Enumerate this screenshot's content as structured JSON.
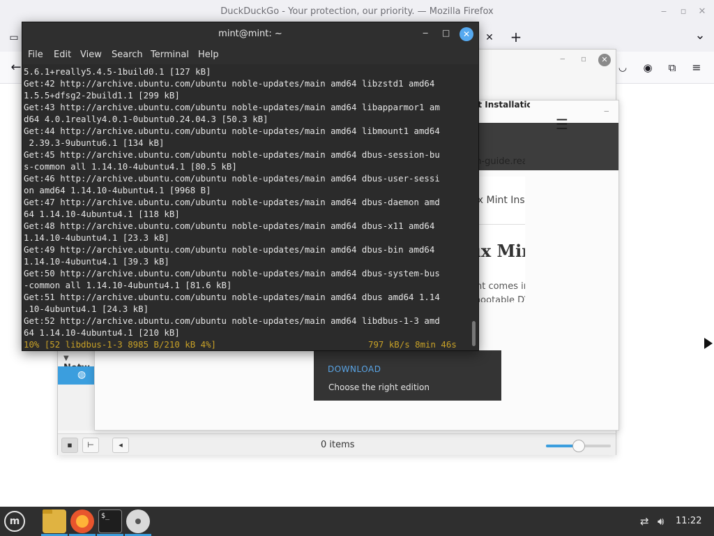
{
  "firefox": {
    "window_title": "DuckDuckGo - Your protection, our priority. — Mozilla Firefox",
    "tab_close": "✕",
    "new_tab": "+",
    "tab_list": "⌄",
    "back": "←",
    "toolbar_icons": [
      "pocket-icon",
      "account-icon",
      "extensions-icon",
      "menu-icon"
    ]
  },
  "file_manager": {
    "network_header": "Netw",
    "status_items": "0 items",
    "zoom_level": 0.5
  },
  "browser": {
    "guide_title": "Linux Mint Installatio",
    "url": "linuxmint-installation-guide.readt",
    "breadcrumb": "» Linux Mint Inst",
    "heading": "Linux Min",
    "paragraph_1": "Linux Mint comes in",
    "paragraph_2": "make a bootable DV",
    "download_label": "DOWNLOAD",
    "choose_label": "Choose the right edition",
    "tab_close": "✕",
    "new_tab": "+"
  },
  "terminal": {
    "title": "mint@mint: ~",
    "menu": [
      "File",
      "Edit",
      "View",
      "Search",
      "Terminal",
      "Help"
    ],
    "lines": [
      "5.6.1+really5.4.5-1build0.1 [127 kB]",
      "Get:42 http://archive.ubuntu.com/ubuntu noble-updates/main amd64 libzstd1 amd64",
      "1.5.5+dfsg2-2build1.1 [299 kB]",
      "Get:43 http://archive.ubuntu.com/ubuntu noble-updates/main amd64 libapparmor1 am",
      "d64 4.0.1really4.0.1-0ubuntu0.24.04.3 [50.3 kB]",
      "Get:44 http://archive.ubuntu.com/ubuntu noble-updates/main amd64 libmount1 amd64",
      " 2.39.3-9ubuntu6.1 [134 kB]",
      "Get:45 http://archive.ubuntu.com/ubuntu noble-updates/main amd64 dbus-session-bu",
      "s-common all 1.14.10-4ubuntu4.1 [80.5 kB]",
      "Get:46 http://archive.ubuntu.com/ubuntu noble-updates/main amd64 dbus-user-sessi",
      "on amd64 1.14.10-4ubuntu4.1 [9968 B]",
      "Get:47 http://archive.ubuntu.com/ubuntu noble-updates/main amd64 dbus-daemon amd",
      "64 1.14.10-4ubuntu4.1 [118 kB]",
      "Get:48 http://archive.ubuntu.com/ubuntu noble-updates/main amd64 dbus-x11 amd64",
      "1.14.10-4ubuntu4.1 [23.3 kB]",
      "Get:49 http://archive.ubuntu.com/ubuntu noble-updates/main amd64 dbus-bin amd64",
      "1.14.10-4ubuntu4.1 [39.3 kB]",
      "Get:50 http://archive.ubuntu.com/ubuntu noble-updates/main amd64 dbus-system-bus",
      "-common all 1.14.10-4ubuntu4.1 [81.6 kB]",
      "Get:51 http://archive.ubuntu.com/ubuntu noble-updates/main amd64 dbus amd64 1.14",
      ".10-4ubuntu4.1 [24.3 kB]",
      "Get:52 http://archive.ubuntu.com/ubuntu noble-updates/main amd64 libdbus-1-3 amd",
      "64 1.14.10-4ubuntu4.1 [210 kB]"
    ],
    "progress": "10% [52 libdbus-1-3 8985 B/210 kB 4%]",
    "rate": "797 kB/s 8min 46s"
  },
  "taskbar": {
    "menu_label": "m",
    "terminal_glyph": "$_",
    "clock": "11:22",
    "apps": [
      "files",
      "firefox",
      "terminal",
      "disc"
    ]
  },
  "colors": {
    "accent": "#3b9ede",
    "terminal_bg": "#2b2b2b",
    "terminal_progress": "#c9a227",
    "taskbar_bg": "#2f2f2f"
  }
}
